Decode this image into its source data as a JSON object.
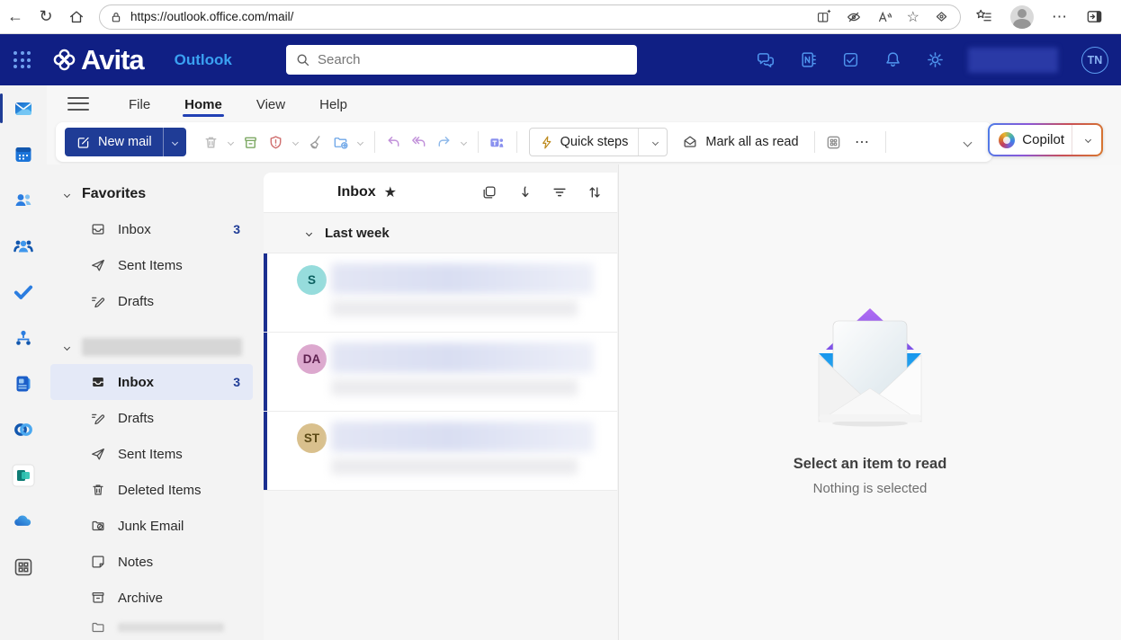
{
  "browser": {
    "url": "https://outlook.office.com/mail/"
  },
  "topbar": {
    "logo_text": "Avita",
    "app_name": "Outlook",
    "search_placeholder": "Search",
    "avatar_initials": "TN"
  },
  "ribbon": {
    "tabs": [
      {
        "label": "File"
      },
      {
        "label": "Home"
      },
      {
        "label": "View"
      },
      {
        "label": "Help"
      }
    ],
    "active_tab": "Home",
    "new_mail_label": "New mail",
    "quick_steps_label": "Quick steps",
    "mark_all_read_label": "Mark all as read",
    "copilot_label": "Copilot"
  },
  "sidebar_folders": {
    "favorites_label": "Favorites",
    "favorites": [
      {
        "label": "Inbox",
        "count": "3"
      },
      {
        "label": "Sent Items",
        "count": ""
      },
      {
        "label": "Drafts",
        "count": ""
      }
    ],
    "account": [
      {
        "label": "Inbox",
        "count": "3"
      },
      {
        "label": "Drafts",
        "count": ""
      },
      {
        "label": "Sent Items",
        "count": ""
      },
      {
        "label": "Deleted Items",
        "count": ""
      },
      {
        "label": "Junk Email",
        "count": ""
      },
      {
        "label": "Notes",
        "count": ""
      },
      {
        "label": "Archive",
        "count": ""
      }
    ]
  },
  "message_list": {
    "title": "Inbox",
    "star_glyph": "★",
    "group_label": "Last week",
    "messages": [
      {
        "initials": "S",
        "avatar_bg": "#96dcdc",
        "avatar_fg": "#0b5f5f"
      },
      {
        "initials": "DA",
        "avatar_bg": "#dca8ce",
        "avatar_fg": "#5f2150"
      },
      {
        "initials": "ST",
        "avatar_bg": "#d9c08d",
        "avatar_fg": "#5c4a16"
      }
    ]
  },
  "reading_pane": {
    "empty_title": "Select an item to read",
    "empty_subtitle": "Nothing is selected"
  },
  "colors": {
    "topbar_bg": "#101f84",
    "accent": "#1f3c96",
    "outlook_blue": "#3aa1f2",
    "unread_bar": "#1b2f90"
  }
}
